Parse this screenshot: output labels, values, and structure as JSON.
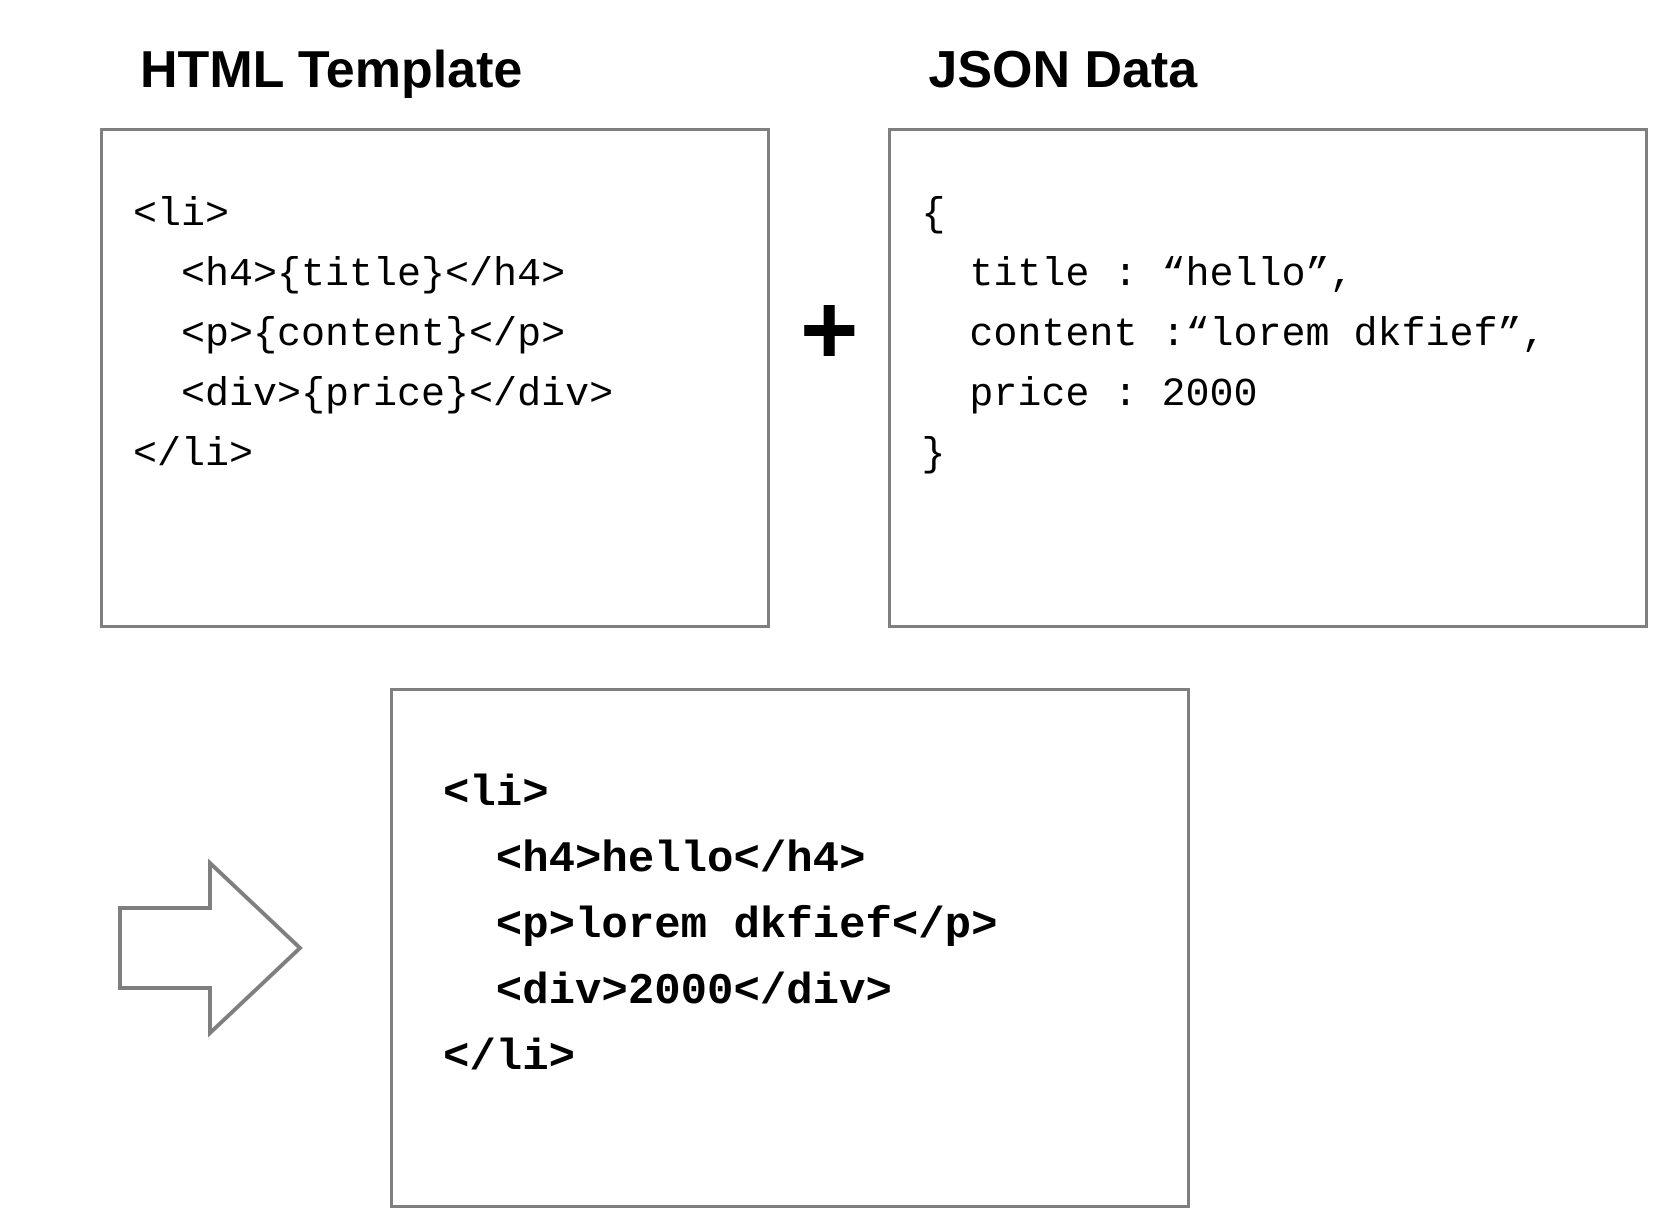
{
  "headings": {
    "template": "HTML Template",
    "json": "JSON Data"
  },
  "template_box": {
    "line1": "<li>",
    "line2": "  <h4>{title}</h4>",
    "line3": "  <p>{content}</p>",
    "line4": "  <div>{price}</div>",
    "line5": "</li>"
  },
  "json_box": {
    "line1": "{",
    "line2": "  title : “hello”,",
    "line3": "  content :“lorem dkfief”,",
    "line4": "  price : 2000",
    "line5": "}"
  },
  "result_box": {
    "line1": "<li>",
    "line2": "  <h4>hello</h4>",
    "line3": "  <p>lorem dkfief</p>",
    "line4": "  <div>2000</div>",
    "line5": "</li>"
  },
  "symbols": {
    "plus": "+"
  }
}
